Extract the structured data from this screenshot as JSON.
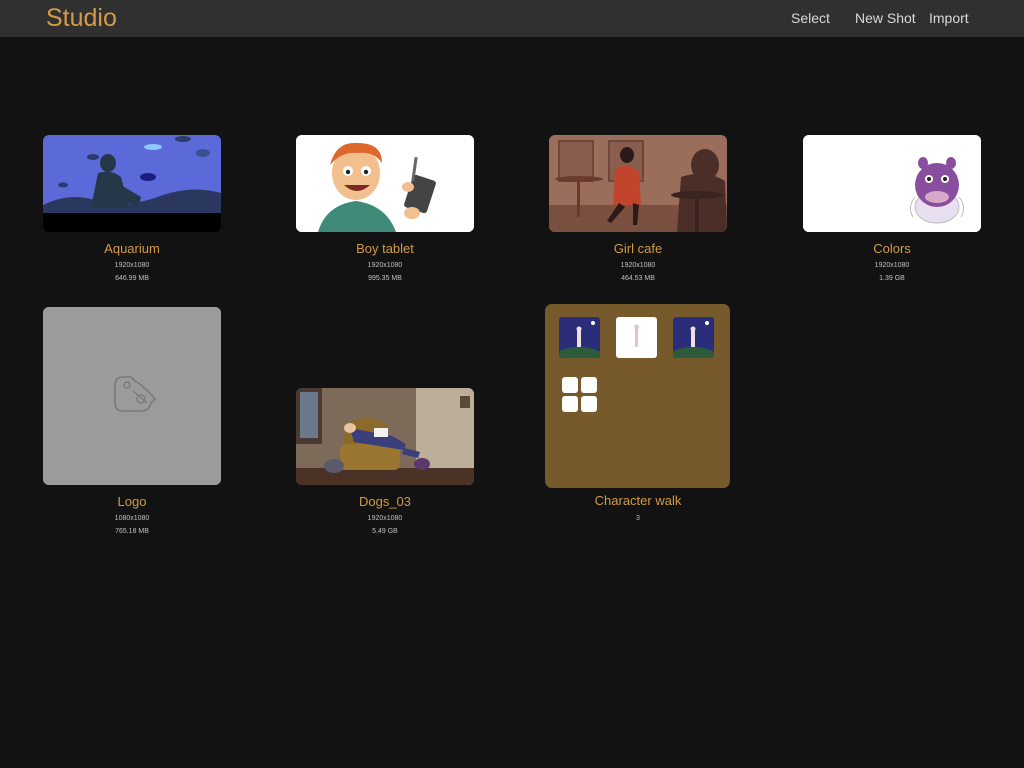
{
  "app": {
    "title": "Studio",
    "actions": {
      "select": "Select",
      "new_shot": "New Shot",
      "import": "Import"
    }
  },
  "colors": {
    "accent": "#d49a45",
    "background": "#121212",
    "topbar": "#303030",
    "folder": "#765a2b"
  },
  "shots": [
    {
      "name": "Aquarium",
      "resolution": "1920x1080",
      "size": "646.99 MB"
    },
    {
      "name": "Boy tablet",
      "resolution": "1920x1080",
      "size": "995.35 MB"
    },
    {
      "name": "Girl cafe",
      "resolution": "1920x1080",
      "size": "464.53 MB"
    },
    {
      "name": "Colors",
      "resolution": "1920x1080",
      "size": "1.39 GB"
    },
    {
      "name": "Logo",
      "resolution": "1080x1080",
      "size": "765.18 MB"
    },
    {
      "name": "Dogs_03",
      "resolution": "1920x1080",
      "size": "5.49 GB"
    }
  ],
  "folder": {
    "name": "Character walk",
    "count": "3"
  }
}
